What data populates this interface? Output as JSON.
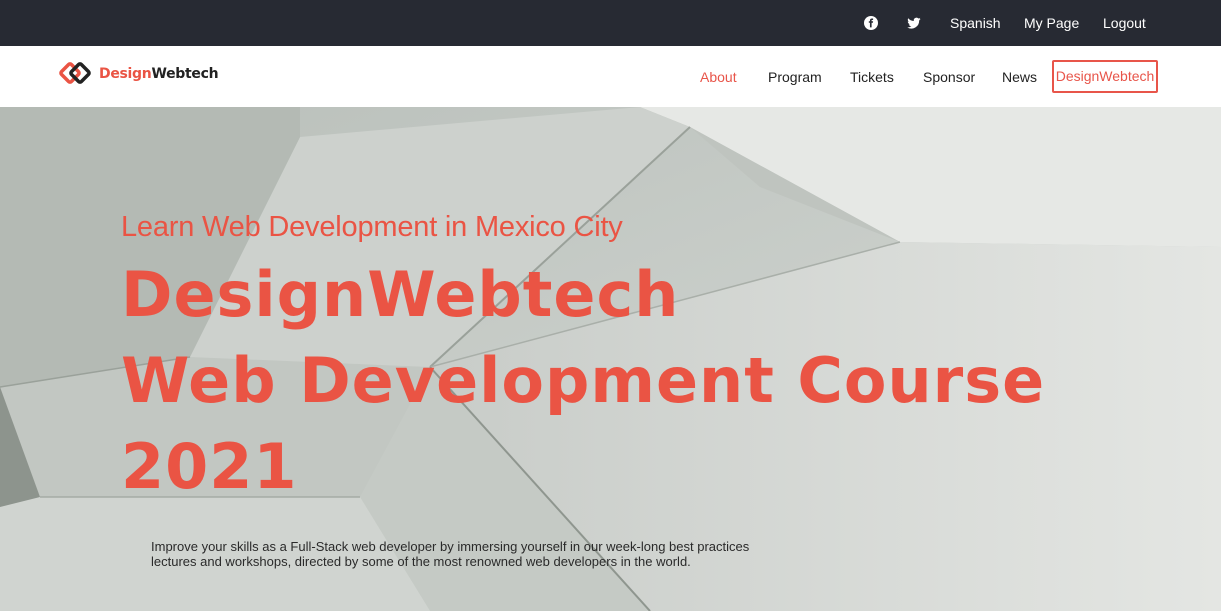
{
  "topbar": {
    "icons": [
      "facebook-icon",
      "twitter-icon"
    ],
    "language_label": "Spanish",
    "mypage_label": "My Page",
    "logout_label": "Logout"
  },
  "brand": {
    "name_part1": "Design",
    "name_part2": "Webtech",
    "accent_color": "#ea5444"
  },
  "nav": {
    "items": [
      {
        "label": "About",
        "active": true
      },
      {
        "label": "Program",
        "active": false
      },
      {
        "label": "Tickets",
        "active": false
      },
      {
        "label": "Sponsor",
        "active": false
      },
      {
        "label": "News",
        "active": false
      }
    ],
    "cta_label": "DesignWebtech"
  },
  "hero": {
    "subtitle": "Learn Web Development in Mexico City",
    "title_lines": [
      "DesignWebtech",
      "Web Development Course",
      "2021"
    ],
    "description_lines": [
      "Improve your skills as a Full-Stack web developer by immersing yourself in our week-long best practices",
      "lectures and workshops, directed by some of the most renowned web developers in the world."
    ]
  }
}
